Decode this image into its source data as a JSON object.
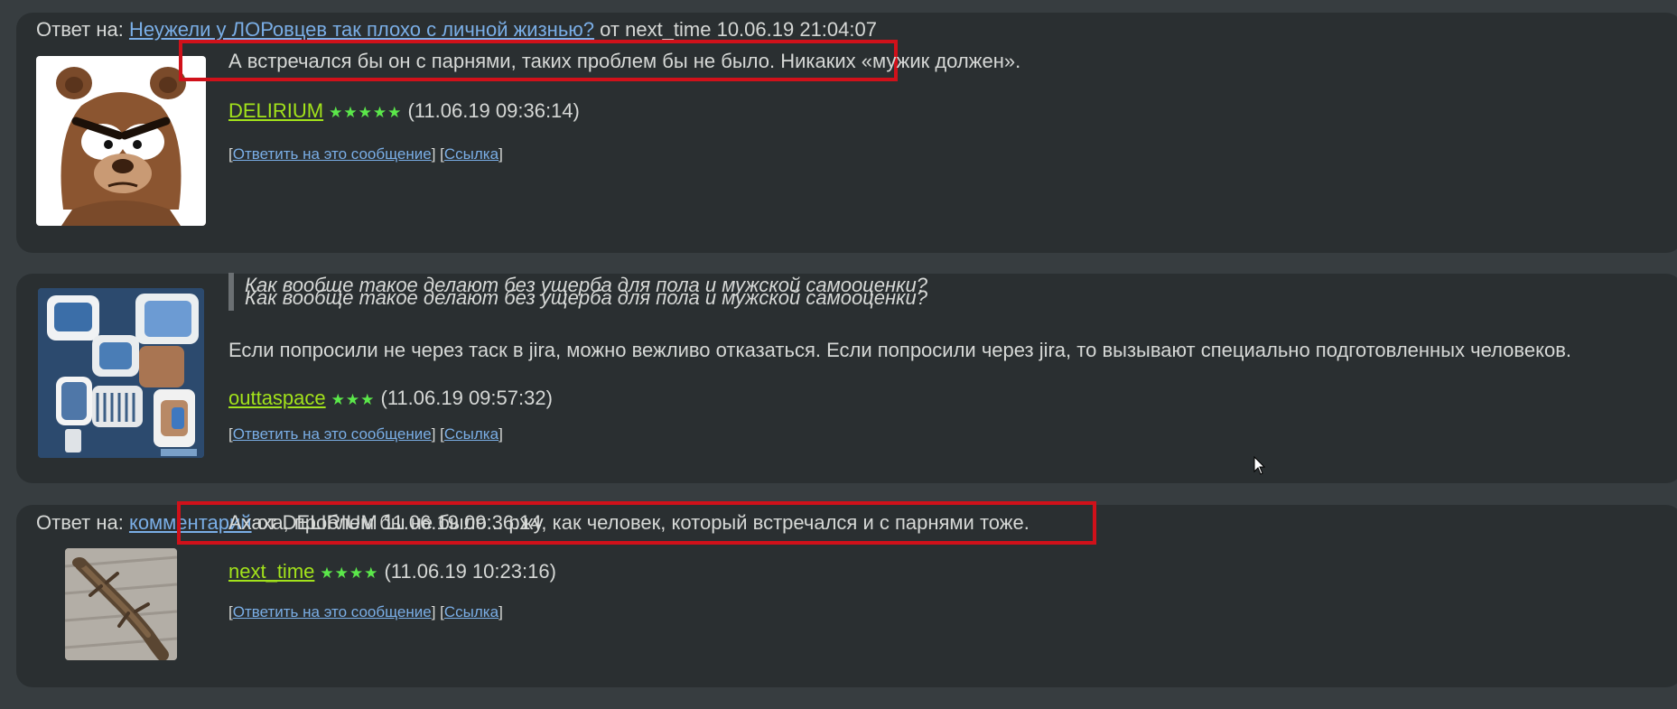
{
  "comments": [
    {
      "reply_prefix": "Ответ на:",
      "reply_topic": "Неужели у ЛОРовцев так плохо с личной жизнью?",
      "reply_suffix": "от next_time 10.06.19 21:04:07",
      "text": "А встречался бы он с парнями, таких проблем бы не было. Никаких «мужик должен».",
      "author": "DELIRIUM",
      "stars": "★★★★★",
      "date": "(11.06.19 09:36:14)",
      "reply_label": "Ответить на это сообщение",
      "link_label": "Ссылка",
      "avatar": "bear-avatar"
    },
    {
      "quote": "Как вообще такое делают без ущерба для пола и мужской самооценки?",
      "text": "Если попросили не через таск в jira, можно вежливо отказаться. Если попросили через jira, то вызывают специально подготовленных человеков.",
      "author": "outtaspace",
      "stars": "★★★",
      "date": "(11.06.19 09:57:32)",
      "reply_label": "Ответить на это сообщение",
      "link_label": "Ссылка",
      "avatar": "abstract-avatar"
    },
    {
      "reply_prefix": "Ответ на:",
      "reply_topic": "комментарий",
      "reply_suffix": "от DELIRIUM 11.06.19 09:36:14",
      "text": "Ахаха, проблем бы не было... ржу, как человек, который встречался и с парнями тоже.",
      "author": "next_time",
      "stars": "★★★★",
      "date": "(11.06.19 10:23:16)",
      "reply_label": "Ответить на это сообщение",
      "link_label": "Ссылка",
      "avatar": "lizard-avatar"
    }
  ],
  "colors": {
    "background": "#373d40",
    "card": "#2a2f31",
    "link": "#7aaee6",
    "nick": "#a2e21b",
    "stars": "#5be84a",
    "highlight": "#d0111a"
  }
}
